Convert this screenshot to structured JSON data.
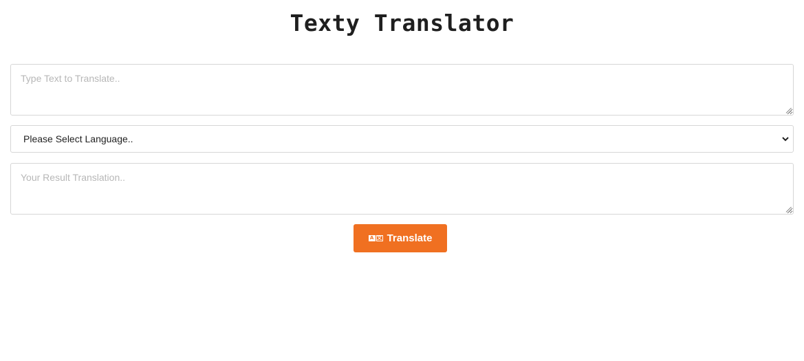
{
  "header": {
    "title": "Texty Translator"
  },
  "source": {
    "value": "",
    "placeholder": "Type Text to Translate.."
  },
  "language_select": {
    "selected": "Please Select Language..",
    "options": [
      "Please Select Language.."
    ]
  },
  "result": {
    "value": "",
    "placeholder": "Your Result Translation.."
  },
  "translate_button": {
    "label": "Translate",
    "icon": "translate-icon"
  },
  "colors": {
    "accent": "#f07021",
    "border": "#d6d6d6",
    "title": "#1f1f1f",
    "placeholder": "#b7b7b7"
  }
}
